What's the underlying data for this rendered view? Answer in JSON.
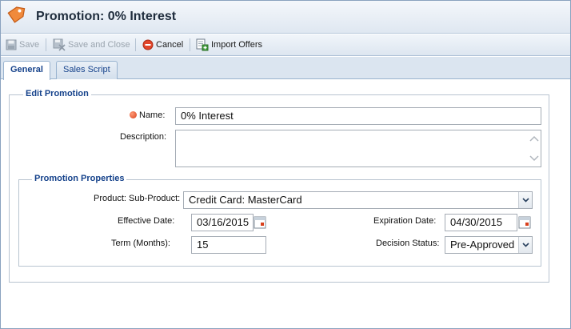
{
  "window": {
    "title": "Promotion: 0% Interest"
  },
  "toolbar": {
    "save_label": "Save",
    "save_close_label": "Save and Close",
    "cancel_label": "Cancel",
    "import_label": "Import Offers"
  },
  "tabs": [
    {
      "label": "General",
      "active": true
    },
    {
      "label": "Sales Script",
      "active": false
    }
  ],
  "edit_promotion": {
    "legend": "Edit Promotion",
    "name_label": "Name:",
    "name_value": "0% Interest",
    "description_label": "Description:",
    "description_value": ""
  },
  "promotion_properties": {
    "legend": "Promotion Properties",
    "product_label": "Product: Sub-Product:",
    "product_value": "Credit Card: MasterCard",
    "effective_date_label": "Effective Date:",
    "effective_date_value": "03/16/2015",
    "expiration_date_label": "Expiration Date:",
    "expiration_date_value": "04/30/2015",
    "term_label": "Term (Months):",
    "term_value": "15",
    "decision_status_label": "Decision Status:",
    "decision_status_value": "Pre-Approved"
  },
  "colors": {
    "accent": "#15428b",
    "required": "#d9401c"
  },
  "icons": {
    "title": "price-tag-icon",
    "save": "save-icon",
    "save_close": "save-close-icon",
    "cancel": "cancel-icon",
    "import": "import-icon",
    "calendar": "calendar-icon",
    "dropdown": "chevron-down-icon"
  }
}
